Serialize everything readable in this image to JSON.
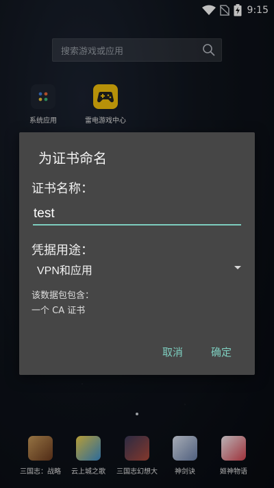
{
  "status_bar": {
    "time": "9:15"
  },
  "search": {
    "placeholder": "搜索游戏或应用"
  },
  "home_apps": [
    {
      "label": "系统应用"
    },
    {
      "label": "雷电游戏中心"
    }
  ],
  "dock_apps": [
    {
      "label": "三国志：战略",
      "color": "#7a4a2a"
    },
    {
      "label": "云上城之歌",
      "color": "#3b8fd0"
    },
    {
      "label": "三国志幻想大",
      "color": "#8a3a3a"
    },
    {
      "label": "神剑诀",
      "color": "#6a7fa8"
    },
    {
      "label": "姬神物语",
      "color": "#e6dce4"
    }
  ],
  "dialog": {
    "title": "为证书命名",
    "name_label": "证书名称：",
    "name_value": "test",
    "usage_label": "凭据用途：",
    "usage_value": "VPN和应用",
    "info_line1": "该数据包包含：",
    "info_line2": "一个 CA 证书",
    "cancel_label": "取消",
    "ok_label": "确定"
  },
  "colors": {
    "accent": "#7ecfc0",
    "dialog_bg": "#464646"
  }
}
